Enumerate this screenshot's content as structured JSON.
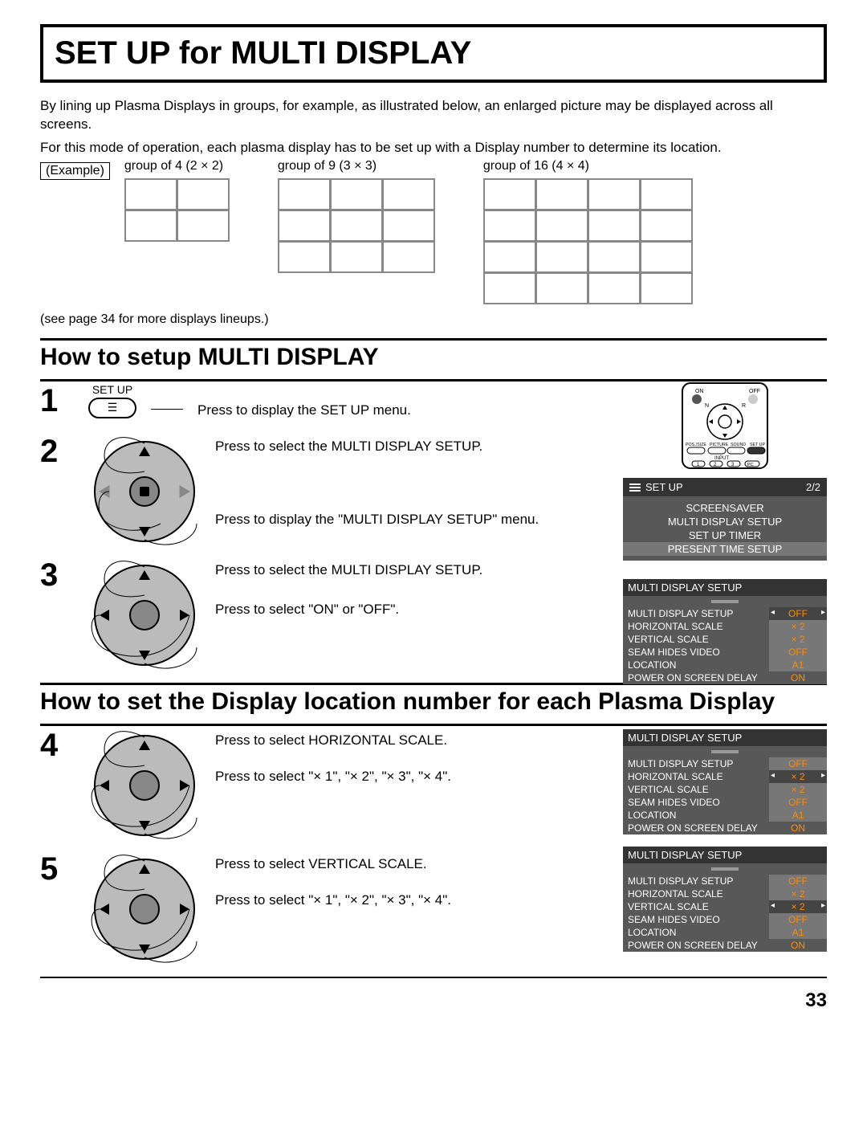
{
  "title": "SET UP for MULTI DISPLAY",
  "intro_p1": "By lining up Plasma Displays in groups, for example, as illustrated below, an enlarged picture may be displayed across all screens.",
  "intro_p2": "For this mode of operation, each plasma display has to be set up with a Display number to determine its location.",
  "example_label": "(Example)",
  "groups": {
    "g2": "group of 4 (2 × 2)",
    "g3": "group of 9 (3 × 3)",
    "g4": "group of 16 (4 × 4)"
  },
  "more_lineups": "(see page 34 for more displays lineups.)",
  "section1_title": "How to setup MULTI DISPLAY",
  "section2_title": "How to set the Display location number for each Plasma Display",
  "steps": {
    "s1": {
      "num": "1",
      "btn_label": "SET UP",
      "text": "Press to display the SET UP menu."
    },
    "s2": {
      "num": "2",
      "line1": "Press to select the MULTI DISPLAY SETUP.",
      "line2": "Press to display the \"MULTI DISPLAY SETUP\" menu."
    },
    "s3": {
      "num": "3",
      "line1": "Press to select the MULTI DISPLAY SETUP.",
      "line2": "Press to select \"ON\" or \"OFF\"."
    },
    "s4": {
      "num": "4",
      "line1": "Press to select HORIZONTAL SCALE.",
      "line2": "Press to select \"× 1\", \"× 2\", \"× 3\", \"× 4\"."
    },
    "s5": {
      "num": "5",
      "line1": "Press to select VERTICAL SCALE.",
      "line2": "Press to select \"× 1\", \"× 2\", \"× 3\", \"× 4\"."
    }
  },
  "osd_setup": {
    "title": "SET UP",
    "page": "2/2",
    "items": [
      "SCREENSAVER",
      "MULTI DISPLAY SETUP",
      "SET UP TIMER",
      "PRESENT TIME SETUP"
    ]
  },
  "osd_mds": {
    "title": "MULTI DISPLAY SETUP",
    "rows": [
      {
        "label": "MULTI DISPLAY SETUP",
        "val": "OFF"
      },
      {
        "label": "HORIZONTAL SCALE",
        "val": "× 2"
      },
      {
        "label": "VERTICAL SCALE",
        "val": "× 2"
      },
      {
        "label": "SEAM HIDES VIDEO",
        "val": "OFF"
      },
      {
        "label": "LOCATION",
        "val": "A1"
      },
      {
        "label": "POWER ON SCREEN DELAY",
        "val": "ON"
      }
    ]
  },
  "remote": {
    "on": "ON",
    "off": "OFF",
    "n": "N",
    "r": "R",
    "pos": "POS./SIZE",
    "pic": "PICTURE",
    "snd": "SOUND",
    "setup": "SET UP",
    "input": "INPUT",
    "b1": "1",
    "b2": "2",
    "b3": "3",
    "pc": "PC"
  },
  "page_number": "33"
}
